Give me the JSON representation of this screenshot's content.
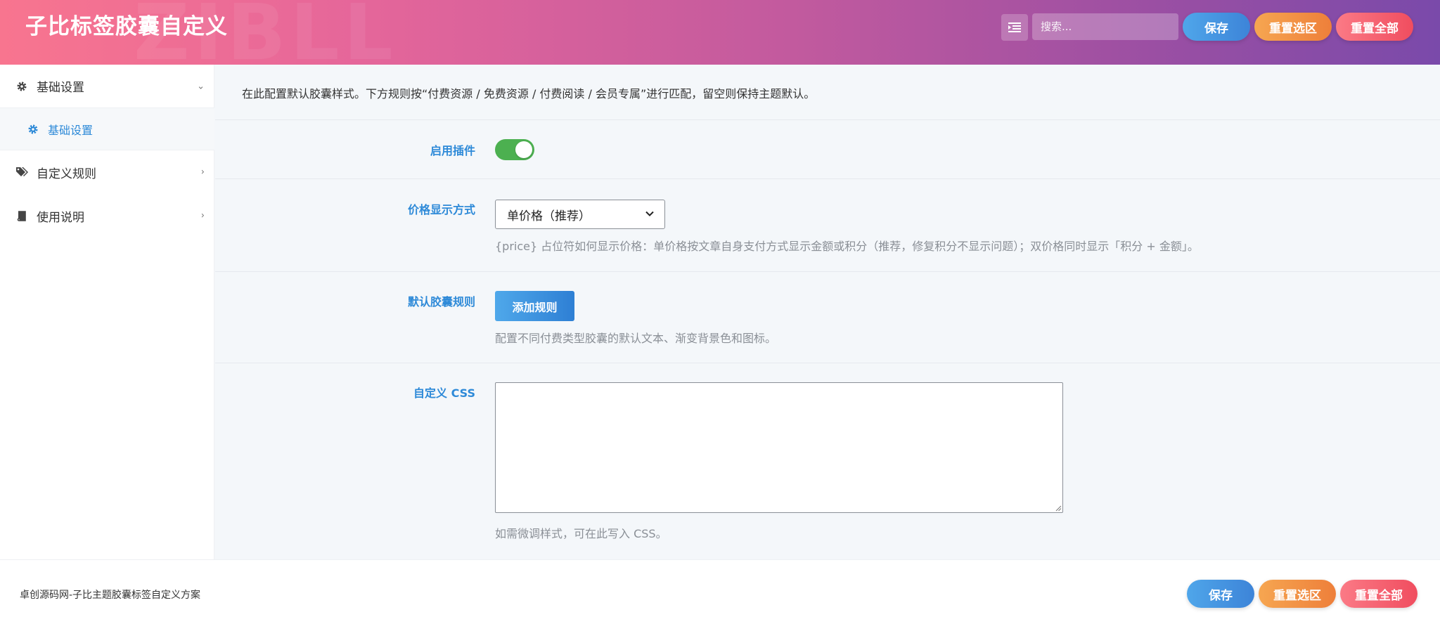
{
  "header": {
    "title": "子比标签胶囊自定义",
    "watermark": "ZIBLL",
    "search_placeholder": "搜索...",
    "save_label": "保存",
    "reset_section_label": "重置选区",
    "reset_all_label": "重置全部"
  },
  "sidebar": {
    "items": [
      {
        "label": "基础设置",
        "icon": "gear-icon",
        "expanded": true
      },
      {
        "label": "自定义规则",
        "icon": "tags-icon",
        "expanded": false
      },
      {
        "label": "使用说明",
        "icon": "book-icon",
        "expanded": false
      }
    ],
    "subitems": [
      {
        "label": "基础设置",
        "icon": "gear-icon",
        "active": true
      }
    ]
  },
  "main": {
    "intro": "在此配置默认胶囊样式。下方规则按“付费资源 / 免费资源 / 付费阅读 / 会员专属”进行匹配，留空则保持主题默认。",
    "enable": {
      "label": "启用插件",
      "value": true
    },
    "price_mode": {
      "label": "价格显示方式",
      "selected": "单价格（推荐）",
      "help": "{price} 占位符如何显示价格：单价格按文章自身支付方式显示金额或积分（推荐，修复积分不显示问题）；双价格同时显示「积分 + 金额」。"
    },
    "default_rules": {
      "label": "默认胶囊规则",
      "button": "添加规则",
      "help": "配置不同付费类型胶囊的默认文本、渐变背景色和图标。"
    },
    "custom_css": {
      "label": "自定义 CSS",
      "value": "",
      "help": "如需微调样式，可在此写入 CSS。"
    }
  },
  "footer": {
    "credit": "卓创源码网-子比主题胶囊标签自定义方案",
    "save_label": "保存",
    "reset_section_label": "重置选区",
    "reset_all_label": "重置全部"
  },
  "colors": {
    "accent": "#2e8ad8",
    "toggle_on": "#4cb050",
    "header_start": "#f8758f",
    "header_end": "#7a4aaa"
  }
}
